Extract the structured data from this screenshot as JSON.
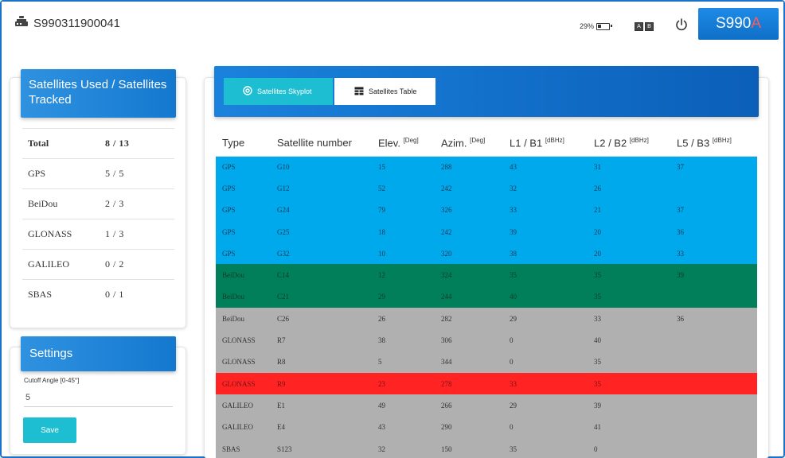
{
  "header": {
    "device_id": "S990311900041",
    "battery_percent": "29%",
    "battery_level": 0.29,
    "language_icon_left": "A",
    "language_icon_right": "B",
    "brand_main": "S990",
    "brand_accent": "A"
  },
  "summary": {
    "title": "Satellites Used / Satellites Tracked",
    "rows": [
      {
        "label": "Total",
        "value": "8 / 13"
      },
      {
        "label": "GPS",
        "value": "5 / 5"
      },
      {
        "label": "BeiDou",
        "value": "2 / 3"
      },
      {
        "label": "GLONASS",
        "value": "1 / 3"
      },
      {
        "label": "GALILEO",
        "value": "0 / 2"
      },
      {
        "label": "SBAS",
        "value": "0 / 1"
      }
    ]
  },
  "settings": {
    "title": "Settings",
    "cutoff_label": "Cutoff Angle [0-45°]",
    "cutoff_value": "5",
    "save_label": "Save"
  },
  "tabs": {
    "skyplot": "Satellites Skyplot",
    "table": "Satellites Table"
  },
  "table": {
    "headers": [
      {
        "text": "Type",
        "unit": ""
      },
      {
        "text": "Satellite number",
        "unit": ""
      },
      {
        "text": "Elev. ",
        "unit": "[Deg]"
      },
      {
        "text": "Azim. ",
        "unit": "[Deg]"
      },
      {
        "text": "L1 / B1 ",
        "unit": "[dBHz]"
      },
      {
        "text": "L2 / B2 ",
        "unit": "[dBHz]"
      },
      {
        "text": "L5 / B3 ",
        "unit": "[dBHz]"
      }
    ],
    "rows": [
      {
        "style": "gps",
        "cells": [
          "GPS",
          "G10",
          "15",
          "288",
          "43",
          "31",
          "37"
        ]
      },
      {
        "style": "gps",
        "cells": [
          "GPS",
          "G12",
          "52",
          "242",
          "32",
          "26",
          ""
        ]
      },
      {
        "style": "gps",
        "cells": [
          "GPS",
          "G24",
          "79",
          "326",
          "33",
          "21",
          "37"
        ]
      },
      {
        "style": "gps",
        "cells": [
          "GPS",
          "G25",
          "18",
          "242",
          "39",
          "20",
          "36"
        ]
      },
      {
        "style": "gps",
        "cells": [
          "GPS",
          "G32",
          "10",
          "320",
          "38",
          "20",
          "33"
        ]
      },
      {
        "style": "bei",
        "cells": [
          "BeiDou",
          "C14",
          "12",
          "324",
          "35",
          "35",
          "39"
        ]
      },
      {
        "style": "bei",
        "cells": [
          "BeiDou",
          "C21",
          "29",
          "244",
          "40",
          "35",
          ""
        ]
      },
      {
        "style": "gray",
        "cells": [
          "BeiDou",
          "C26",
          "26",
          "282",
          "29",
          "33",
          "36"
        ]
      },
      {
        "style": "gray",
        "cells": [
          "GLONASS",
          "R7",
          "38",
          "306",
          "0",
          "40",
          ""
        ]
      },
      {
        "style": "gray",
        "cells": [
          "GLONASS",
          "R8",
          "5",
          "344",
          "0",
          "35",
          ""
        ]
      },
      {
        "style": "red",
        "cells": [
          "GLONASS",
          "R9",
          "23",
          "278",
          "33",
          "35",
          ""
        ]
      },
      {
        "style": "gray",
        "cells": [
          "GALILEO",
          "E1",
          "49",
          "266",
          "29",
          "39",
          ""
        ]
      },
      {
        "style": "gray",
        "cells": [
          "GALILEO",
          "E4",
          "43",
          "290",
          "0",
          "41",
          ""
        ]
      },
      {
        "style": "gray",
        "cells": [
          "SBAS",
          "S123",
          "32",
          "150",
          "35",
          "0",
          ""
        ]
      }
    ]
  },
  "colors": {
    "accent": "#1478cf",
    "button": "#1ebed2",
    "used_gps": "#00a8ec",
    "used_beidou": "#017f5a",
    "not_used": "#b0b0b0",
    "used_glonass": "#ff2323",
    "brand_accent": "#ff5a5a"
  },
  "icons": {
    "device": "receiver-icon",
    "battery": "battery-icon",
    "language": "language-icon",
    "power": "power-icon",
    "skyplot": "target-icon",
    "table": "table-icon"
  }
}
